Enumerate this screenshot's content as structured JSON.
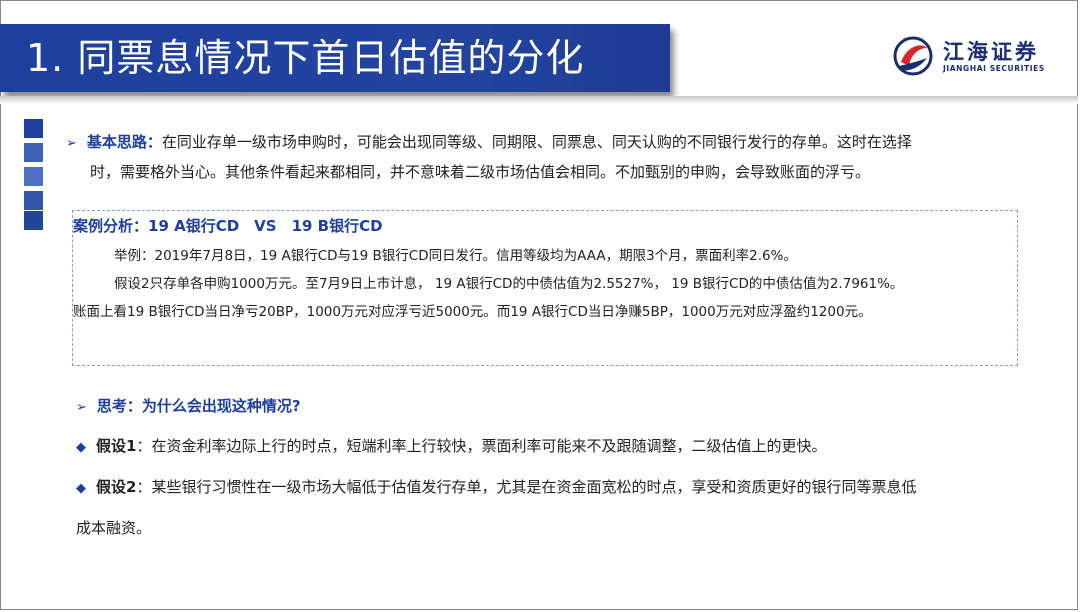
{
  "header": {
    "title": "1. 同票息情况下首日估值的分化",
    "logo_cn": "江海证券",
    "logo_en": "JIANGHAI SECURITIES"
  },
  "basic": {
    "label": "基本思路：",
    "line1": "在同业存单一级市场申购时，可能会出现同等级、同期限、同票息、同天认购的不同银行发行的存单。这时在选择",
    "line2": "时，需要格外当心。其他条件看起来都相同，并不意味着二级市场估值会相同。不加甄别的申购，会导致账面的浮亏。"
  },
  "case": {
    "title": "案例分析：19 A银行CD　VS　19 B银行CD",
    "line1": "举例：2019年7月8日，19 A银行CD与19 B银行CD同日发行。信用等级均为AAA，期限3个月，票面利率2.6%。",
    "line2": "假设2只存单各申购1000万元。至7月9日上市计息， 19 A银行CD的中债估值为2.5527%， 19 B银行CD的中债估值为2.7961%。",
    "line3": "账面上看19 B银行CD当日净亏20BP，1000万元对应浮亏近5000元。而19 A银行CD当日净赚5BP，1000万元对应浮盈约1200元。"
  },
  "think": {
    "label": "思考：为什么会出现这种情况?"
  },
  "hyp1": {
    "label": "假设1",
    "text": "：在资金利率边际上行的时点，短端利率上行较快，票面利率可能来不及跟随调整，二级估值上的更快。"
  },
  "hyp2": {
    "label": "假设2",
    "text": "：某些银行习惯性在一级市场大幅低于估值发行存单，尤其是在资金面宽松的时点，享受和资质更好的银行同等票息低",
    "text2": "成本融资。"
  },
  "colors": {
    "brand_blue": "#1f3f9e",
    "logo_red": "#d4282e"
  }
}
